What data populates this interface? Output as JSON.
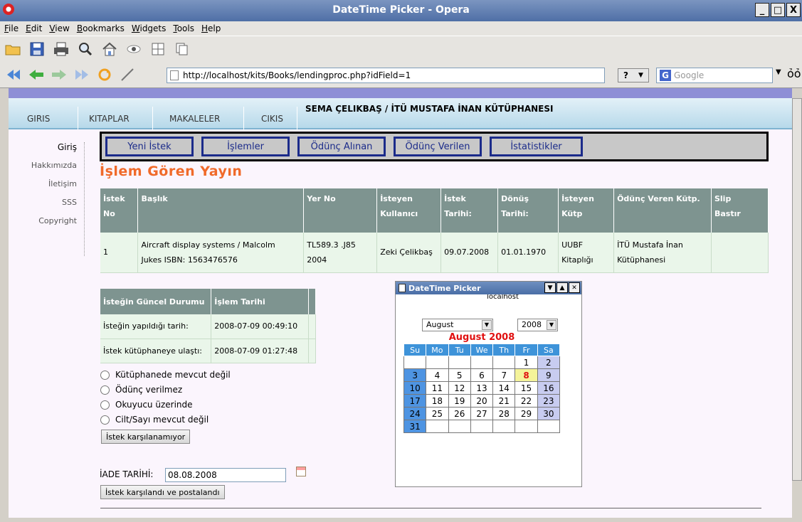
{
  "window": {
    "title": "DateTime Picker - Opera",
    "minimize": "_",
    "maximize": "□",
    "close": "X"
  },
  "menubar": [
    "File",
    "Edit",
    "View",
    "Bookmarks",
    "Widgets",
    "Tools",
    "Help"
  ],
  "addressbar": {
    "url": "http://localhost/kits/Books/lendingproc.php?idField=1",
    "help": "?",
    "search_placeholder": "Google"
  },
  "mainnav": {
    "items": [
      "GIRIS",
      "KITAPLAR",
      "MAKALELER",
      "CIKIS"
    ],
    "library": "SEMA ÇELIKBAŞ / İTÜ MUSTAFA İNAN KÜTÜPHANESI"
  },
  "sidemenu": [
    "Giriş",
    "Hakkımızda",
    "İletişim",
    "SSS",
    "Copyright"
  ],
  "subnav": [
    "Yeni İstek",
    "İşlemler",
    "Ödünç Alınan",
    "Ödünç Verilen",
    "İstatistikler"
  ],
  "page_title": "İşlem Gören Yayın",
  "request_table": {
    "headers": [
      [
        "İstek",
        "No"
      ],
      [
        "Başlık"
      ],
      [
        "Yer No"
      ],
      [
        "İsteyen",
        "Kullanıcı"
      ],
      [
        "İstek",
        "Tarihi:"
      ],
      [
        "Dönüş",
        "Tarihi:"
      ],
      [
        "İsteyen",
        "Kütp"
      ],
      [
        "Ödünç Veren Kütp."
      ],
      [
        "Slip",
        "Bastır"
      ]
    ],
    "row": {
      "no": "1",
      "title_line1": "Aircraft display systems / Malcolm",
      "title_line2": "Jukes ISBN: 1563476576",
      "yer_no_line1": "TL589.3 .J85",
      "yer_no_line2": "2004",
      "user": "Zeki Çelikbaş",
      "request_date": "09.07.2008",
      "return_date": "01.01.1970",
      "req_lib_line1": "UUBF",
      "req_lib_line2": "Kitaplığı",
      "lend_lib_line1": "İTÜ Mustafa İnan",
      "lend_lib_line2": "Kütüphanesi",
      "slip": ""
    }
  },
  "status_table": {
    "headers": [
      "İsteğin Güncel Durumu",
      "İşlem Tarihi"
    ],
    "rows": [
      [
        "İsteğin yapıldığı tarih:",
        "2008-07-09 00:49:10"
      ],
      [
        "İstek kütüphaneye ulaştı:",
        "2008-07-09 01:27:48"
      ]
    ]
  },
  "options": [
    "Kütüphanede mevcut değil",
    "Ödünç verilmez",
    "Okuyucu üzerinde",
    "Cilt/Sayı mevcut değil"
  ],
  "unmet_button": "İstek karşılanamıyor",
  "return": {
    "label": "İADE TARİHİ:",
    "value": "08.08.2008",
    "button": "İstek karşılandı ve postalandı"
  },
  "picker": {
    "title": "DateTime Picker",
    "host": "localhost",
    "month": "August",
    "year": "2008",
    "heading": "August 2008",
    "weekdays": [
      "Su",
      "Mo",
      "Tu",
      "We",
      "Th",
      "Fr",
      "Sa"
    ],
    "weeks": [
      [
        "",
        "",
        "",
        "",
        "",
        "1",
        "2"
      ],
      [
        "3",
        "4",
        "5",
        "6",
        "7",
        "8",
        "9"
      ],
      [
        "10",
        "11",
        "12",
        "13",
        "14",
        "15",
        "16"
      ],
      [
        "17",
        "18",
        "19",
        "20",
        "21",
        "22",
        "23"
      ],
      [
        "24",
        "25",
        "26",
        "27",
        "28",
        "29",
        "30"
      ],
      [
        "31",
        "",
        "",
        "",
        "",
        "",
        ""
      ]
    ],
    "today": "8"
  },
  "colors": {
    "accent_title": "#f06a2a",
    "header_bg": "#7e9490",
    "row_bg": "#eaf6ea",
    "tab_border": "#1b2b8a",
    "today_text": "#e01010"
  }
}
